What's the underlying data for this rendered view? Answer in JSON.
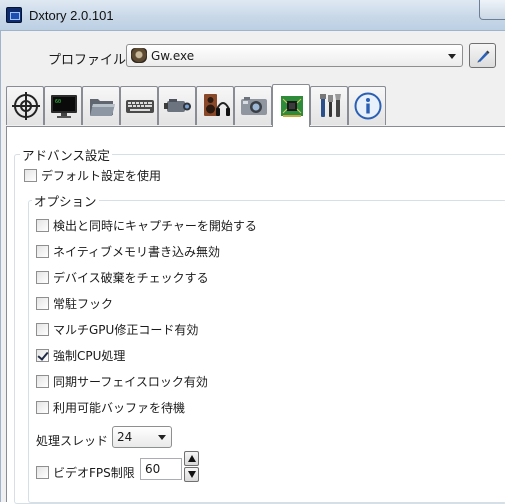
{
  "window": {
    "title": "Dxtory 2.0.101"
  },
  "profile": {
    "label": "プロファイル",
    "value": "Gw.exe"
  },
  "tabs": [
    {
      "icon": "crosshair-icon",
      "name": "tab-target"
    },
    {
      "icon": "monitor-icon",
      "name": "tab-display"
    },
    {
      "icon": "folder-icon",
      "name": "tab-folder"
    },
    {
      "icon": "keyboard-icon",
      "name": "tab-hotkey"
    },
    {
      "icon": "camcorder-icon",
      "name": "tab-movie"
    },
    {
      "icon": "speaker-headphones-icon",
      "name": "tab-audio"
    },
    {
      "icon": "camera-icon",
      "name": "tab-screenshot"
    },
    {
      "icon": "circuit-board-icon",
      "name": "tab-advanced"
    },
    {
      "icon": "tools-icon",
      "name": "tab-tools"
    },
    {
      "icon": "info-icon",
      "name": "tab-info"
    }
  ],
  "active_tab": 7,
  "advanced": {
    "title": "アドバンス設定",
    "use_default": {
      "label": "デフォルト設定を使用",
      "checked": false
    }
  },
  "options": {
    "title": "オプション",
    "items": [
      {
        "label": "検出と同時にキャプチャーを開始する",
        "checked": false
      },
      {
        "label": "ネイティブメモリ書き込み無効",
        "checked": false
      },
      {
        "label": "デバイス破棄をチェックする",
        "checked": false
      },
      {
        "label": "常駐フック",
        "checked": false
      },
      {
        "label": "マルチGPU修正コード有効",
        "checked": false
      },
      {
        "label": "強制CPU処理",
        "checked": true
      },
      {
        "label": "同期サーフェイスロック有効",
        "checked": false
      },
      {
        "label": "利用可能バッファを待機",
        "checked": false
      }
    ],
    "thread": {
      "label": "処理スレッド",
      "value": "24"
    },
    "video_fps": {
      "label": "ビデオFPS制限",
      "checked": false,
      "value": "60"
    }
  }
}
